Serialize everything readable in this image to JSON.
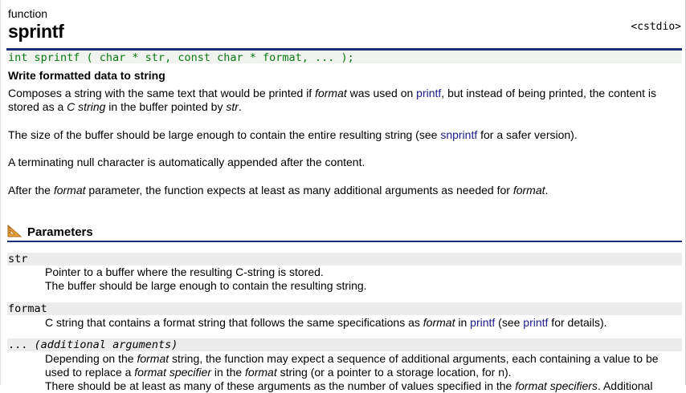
{
  "page": {
    "kind": "function",
    "name": "sprintf",
    "header": "<cstdio>",
    "prototype": "int sprintf ( char * str, const char * format, ... );",
    "summary": "Write formatted data to string"
  },
  "description": {
    "p1": {
      "a": "Composes a string with the same text that would be printed if ",
      "b": "format",
      "c": " was used on ",
      "link": "printf",
      "d": ", but instead of being printed, the content is stored as a ",
      "e": "C string",
      "f": " in the buffer pointed by ",
      "g": "str",
      "h": "."
    },
    "p2": {
      "a": "The size of the buffer should be large enough to contain the entire resulting string (see ",
      "link": "snprintf",
      "b": " for a safer version)."
    },
    "p3": "A terminating null character is automatically appended after the content.",
    "p4": {
      "a": "After the ",
      "b": "format",
      "c": " parameter, the function expects at least as many additional arguments as needed for ",
      "d": "format",
      "e": "."
    }
  },
  "parameters": {
    "heading": "Parameters",
    "icon": "set-square-icon",
    "str": {
      "name": "str",
      "line1": "Pointer to a buffer where the resulting C-string is stored.",
      "line2": "The buffer should be large enough to contain the resulting string."
    },
    "format": {
      "name": "format",
      "a": "C string that contains a format string that follows the same specifications as ",
      "b": "format",
      "c": " in ",
      "link1": "printf",
      "d": " (see ",
      "link2": "printf",
      "e": " for details)."
    },
    "additional": {
      "name_prefix": "...",
      "name_italic": "(additional arguments)",
      "a": "Depending on the ",
      "b": "format",
      "c": " string, the function may expect a sequence of additional arguments, each containing a value to be used to replace a ",
      "d": "format specifier",
      "e": " in the ",
      "f": "format",
      "g": " string (or a pointer to a storage location, for n).",
      "h": "There should be at least as many of these arguments as the number of values specified in the ",
      "i": "format specifiers",
      "j": ". Additional"
    }
  }
}
